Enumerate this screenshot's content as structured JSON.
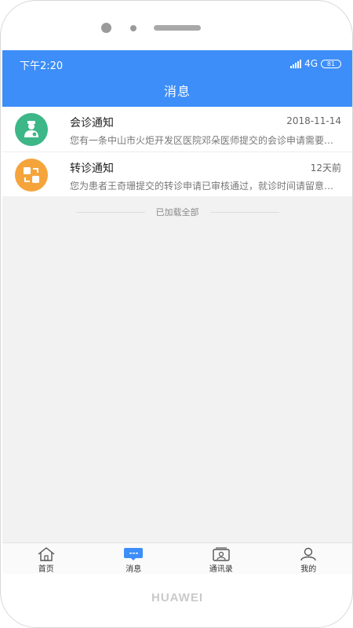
{
  "device": {
    "brand": "HUAWEI"
  },
  "status_bar": {
    "time": "下午2:20",
    "network": "4G",
    "battery": "81"
  },
  "header": {
    "title": "消息"
  },
  "messages": [
    {
      "title": "会诊通知",
      "time": "2018-11-14",
      "preview": "您有一条中山市火炬开发区医院邓朵医师提交的会诊申请需要处理，请及时查看",
      "icon": "doctor-icon",
      "color": "#3db788"
    },
    {
      "title": "转诊通知",
      "time": "12天前",
      "preview": "您为患者王奇珊提交的转诊申请已审核通过，就诊时间请留意后续通知",
      "icon": "transfer-icon",
      "color": "#f5a43c"
    }
  ],
  "list_footer": "已加载全部",
  "tabs": [
    {
      "label": "首页",
      "icon": "home-icon"
    },
    {
      "label": "消息",
      "icon": "message-icon",
      "active": true
    },
    {
      "label": "通讯录",
      "icon": "contacts-icon"
    },
    {
      "label": "我的",
      "icon": "profile-icon"
    }
  ],
  "colors": {
    "primary": "#3d8ef8",
    "background": "#f2f2f2"
  }
}
